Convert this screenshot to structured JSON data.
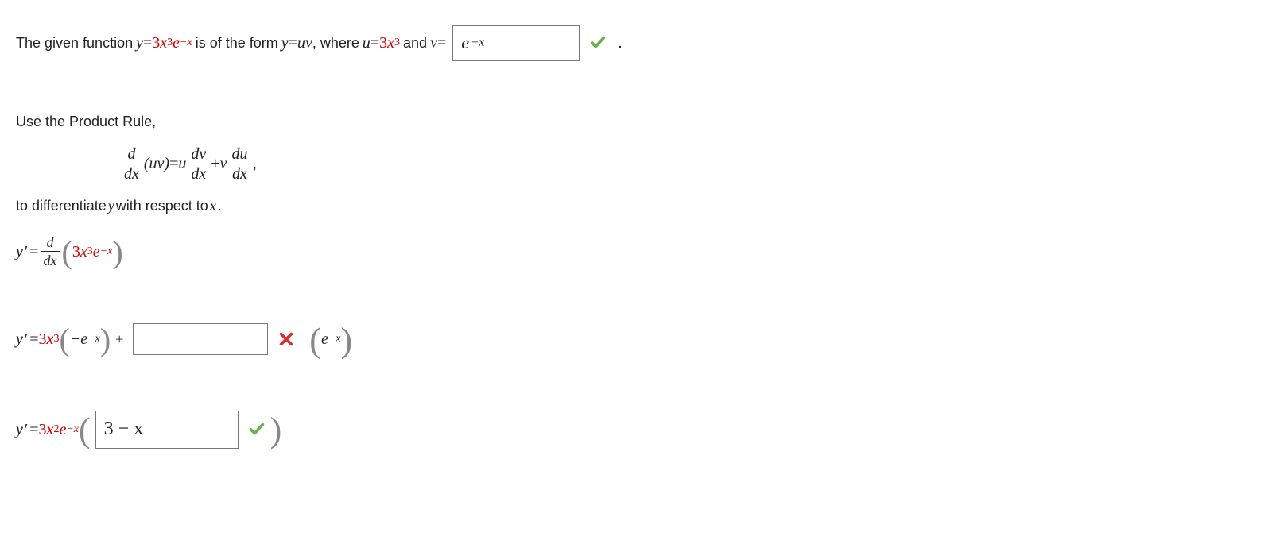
{
  "line1": {
    "pre": "The given function ",
    "y_eq": "y",
    "eq1": " = ",
    "coeff1": "3",
    "x1": "x",
    "pow1": "3",
    "e1": "e",
    "negx1": "−x",
    "mid1": " is of the form ",
    "y2": "y",
    "eq2": " = ",
    "uv": "uv",
    "mid2": ", where ",
    "u": "u",
    "eq3": " = ",
    "coeff2": "3",
    "x2": "x",
    "pow2": "3",
    "mid3": " and ",
    "v": "v",
    "eq4": " = ",
    "answer1": {
      "base": "e",
      "exp": "−x"
    },
    "period": "."
  },
  "line2_a": "Use the Product Rule,",
  "product_rule": {
    "lhs_num": "d",
    "lhs_den": "dx",
    "lhs_arg": "(uv)",
    "eq": " = ",
    "t1_coef": "u",
    "t1_num": "dv",
    "t1_den": "dx",
    "plus": " + ",
    "t2_coef": "v",
    "t2_num": "du",
    "t2_den": "dx",
    "comma": ","
  },
  "line2_b": {
    "pre": "to differentiate ",
    "y": "y",
    "mid": " with respect to ",
    "x": "x",
    "post": "."
  },
  "step1": {
    "y": "y",
    "prime": "′",
    "eq": " = ",
    "num": "d",
    "den": "dx",
    "coeff": "3",
    "x": "x",
    "pow": "3",
    "e": "e",
    "negx": "−x"
  },
  "step2": {
    "y": "y",
    "prime": "′",
    "eq": " = ",
    "coeff": "3",
    "x": "x",
    "pow": "3",
    "neg_e": "−e",
    "negx": "−x",
    "plus": " + ",
    "answer2": "",
    "e2": "e",
    "negx2": "−x"
  },
  "step3": {
    "y": "y",
    "prime": "′",
    "eq": " = ",
    "coeff": "3",
    "x": "x",
    "pow": "2",
    "e": "e",
    "negx": "−x",
    "answer3": "3 − x"
  }
}
